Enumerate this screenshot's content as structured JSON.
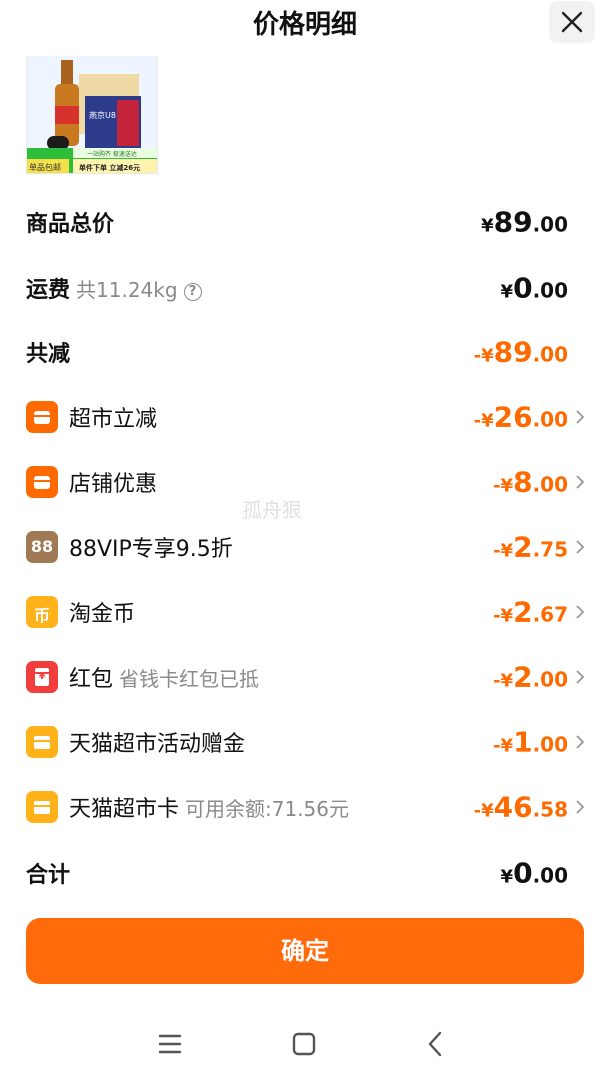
{
  "header": {
    "title": "价格明细"
  },
  "product": {
    "badge_left": "单品包邮",
    "banner_top": "一站购齐 极速送达",
    "banner_bottom": "单件下单 立减26元",
    "brand_label": "燕京U8"
  },
  "rows": [
    {
      "label": "商品总价",
      "sub": "",
      "amount": {
        "sign": "",
        "currency": "¥",
        "int": "89",
        "dec": ".00"
      }
    },
    {
      "label": "运费",
      "sub": "共11.24kg",
      "help": "?",
      "amount": {
        "sign": "",
        "currency": "¥",
        "int": "0",
        "dec": ".00"
      }
    },
    {
      "label": "共减",
      "sub": "",
      "amount": {
        "sign": "-",
        "currency": "¥",
        "int": "89",
        "dec": ".00"
      }
    },
    {
      "label": "超市立减",
      "sub": "",
      "amount": {
        "sign": "-",
        "currency": "¥",
        "int": "26",
        "dec": ".00"
      }
    },
    {
      "label": "店铺优惠",
      "sub": "",
      "amount": {
        "sign": "-",
        "currency": "¥",
        "int": "8",
        "dec": ".00"
      }
    },
    {
      "label": "88VIP专享9.5折",
      "sub": "",
      "icon_text": "88",
      "amount": {
        "sign": "-",
        "currency": "¥",
        "int": "2",
        "dec": ".75"
      }
    },
    {
      "label": "淘金币",
      "sub": "",
      "icon_text": "币",
      "amount": {
        "sign": "-",
        "currency": "¥",
        "int": "2",
        "dec": ".67"
      }
    },
    {
      "label": "红包",
      "sub": "省钱卡红包已抵",
      "icon_text": "¥",
      "amount": {
        "sign": "-",
        "currency": "¥",
        "int": "2",
        "dec": ".00"
      }
    },
    {
      "label": "天猫超市活动赠金",
      "sub": "",
      "amount": {
        "sign": "-",
        "currency": "¥",
        "int": "1",
        "dec": ".00"
      }
    },
    {
      "label": "天猫超市卡",
      "sub": "可用余额:71.56元",
      "amount": {
        "sign": "-",
        "currency": "¥",
        "int": "46",
        "dec": ".58"
      }
    },
    {
      "label": "合计",
      "sub": "",
      "amount": {
        "sign": "",
        "currency": "¥",
        "int": "0",
        "dec": ".00"
      }
    }
  ],
  "confirm_label": "确定",
  "watermark": "孤舟狠",
  "colors": {
    "accent": "#ff6a00",
    "button": "#ff6a0b",
    "gold": "#ffb21a",
    "brown": "#a07a55",
    "red": "#f23d3d"
  },
  "icons": [
    "close-icon",
    "shop-icon",
    "vip88-icon",
    "coin-icon",
    "red-packet-icon",
    "card-icon",
    "chevron-right-icon",
    "menu-icon",
    "home-icon",
    "back-icon"
  ]
}
